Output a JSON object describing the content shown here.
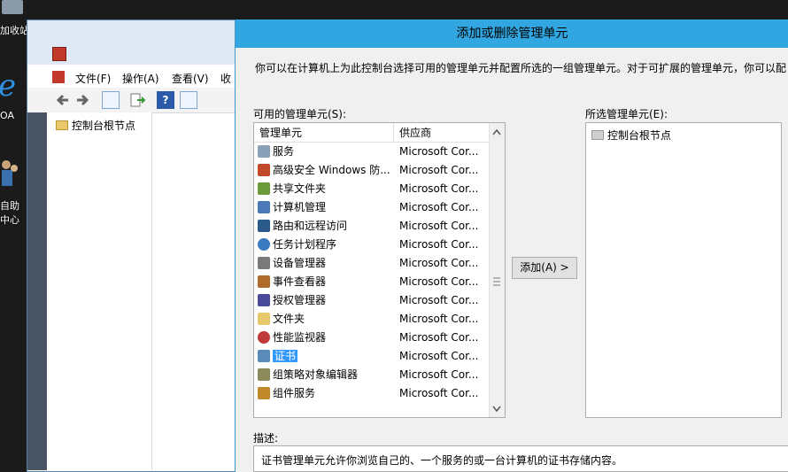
{
  "desktop": {
    "icon1_label": "加收站",
    "icon2_label": "OA",
    "icon3_label_line1": "自助",
    "icon3_label_line2": "中心"
  },
  "console": {
    "menu": [
      "文件(F)",
      "操作(A)",
      "查看(V)",
      "收"
    ],
    "tree_root": "控制台根节点"
  },
  "dialog": {
    "title": "添加或删除管理单元",
    "description": "你可以在计算机上为此控制台选择可用的管理单元并配置所选的一组管理单元。对于可扩展的管理单元，你可以配",
    "available_label": "可用的管理单元(S):",
    "selected_label": "所选管理单元(E):",
    "columns": {
      "snapin": "管理单元",
      "vendor": "供应商"
    },
    "snapins": [
      {
        "name": "服务",
        "vendor": "Microsoft Cor...",
        "icon": "gear-icon"
      },
      {
        "name": "高级安全 Windows 防...",
        "vendor": "Microsoft Cor...",
        "icon": "firewall-icon"
      },
      {
        "name": "共享文件夹",
        "vendor": "Microsoft Cor...",
        "icon": "shared-folder-icon"
      },
      {
        "name": "计算机管理",
        "vendor": "Microsoft Cor...",
        "icon": "computer-management-icon"
      },
      {
        "name": "路由和远程访问",
        "vendor": "Microsoft Cor...",
        "icon": "routing-icon"
      },
      {
        "name": "任务计划程序",
        "vendor": "Microsoft Cor...",
        "icon": "clock-icon"
      },
      {
        "name": "设备管理器",
        "vendor": "Microsoft Cor...",
        "icon": "device-manager-icon"
      },
      {
        "name": "事件查看器",
        "vendor": "Microsoft Cor...",
        "icon": "event-viewer-icon"
      },
      {
        "name": "授权管理器",
        "vendor": "Microsoft Cor...",
        "icon": "authorization-icon"
      },
      {
        "name": "文件夹",
        "vendor": "Microsoft Cor...",
        "icon": "folder-icon"
      },
      {
        "name": "性能监视器",
        "vendor": "Microsoft Cor...",
        "icon": "performance-icon"
      },
      {
        "name": "证书",
        "vendor": "Microsoft Cor...",
        "icon": "certificate-icon",
        "selected": true
      },
      {
        "name": "组策略对象编辑器",
        "vendor": "Microsoft Cor...",
        "icon": "group-policy-icon"
      },
      {
        "name": "组件服务",
        "vendor": "Microsoft Cor...",
        "icon": "component-services-icon"
      }
    ],
    "add_button": "添加(A) >",
    "selected_items": [
      "控制台根节点"
    ],
    "desc_label": "描述:",
    "desc_text": "证书管理单元允许你浏览自己的、一个服务的或一台计算机的证书存储内容。"
  },
  "colors": {
    "title_bar": "#32a6e0",
    "selection": "#3399ff",
    "highlight_box": "#e0141e"
  }
}
